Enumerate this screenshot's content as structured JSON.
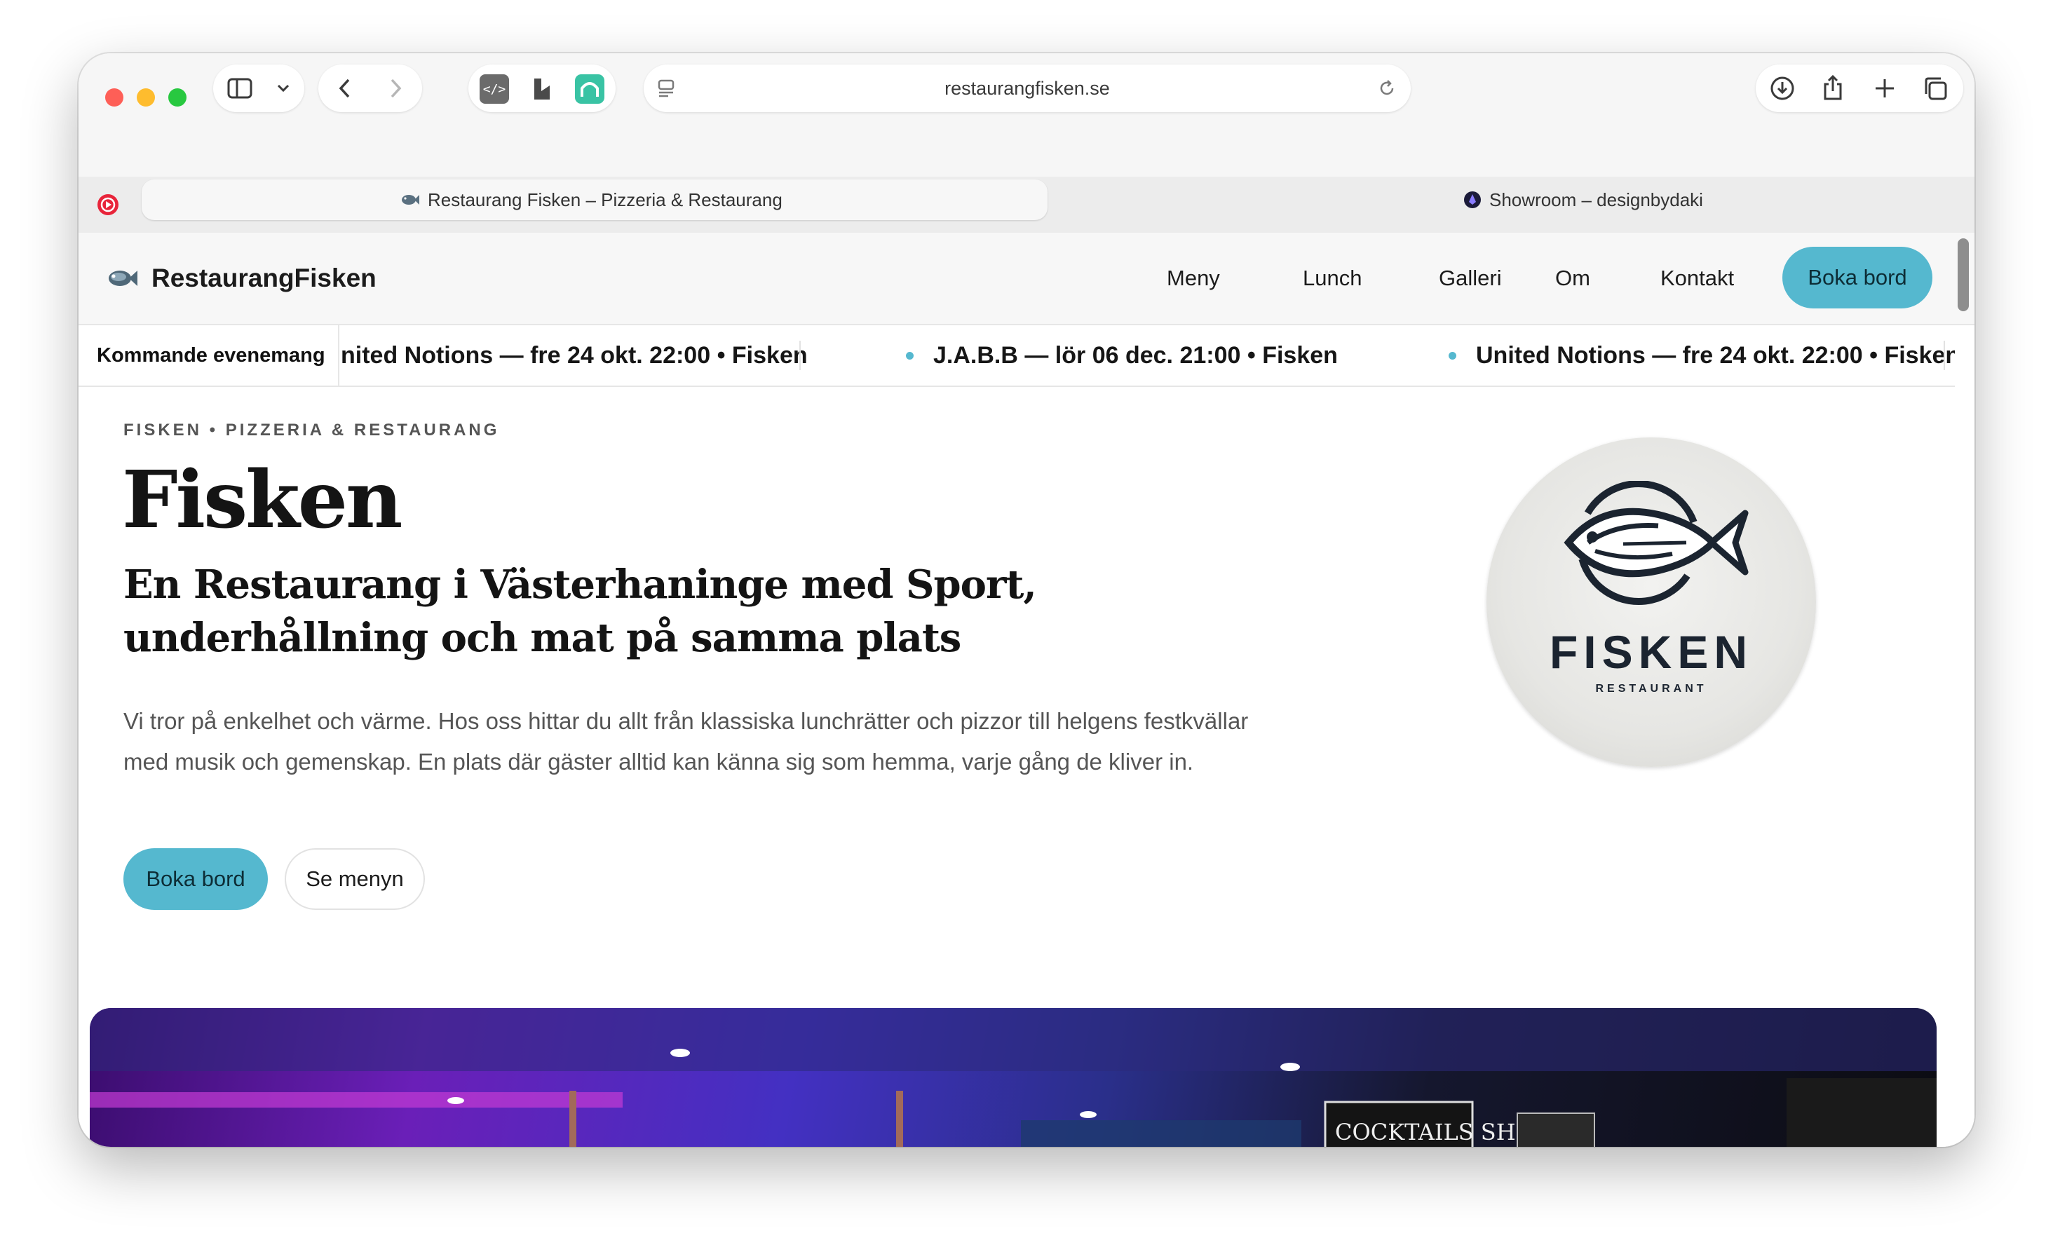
{
  "browser": {
    "url": "restaurangfisken.se",
    "tabs": [
      {
        "label": "Restaurang Fisken – Pizzeria & Restaurang",
        "active": true
      },
      {
        "label": "Showroom – designbydaki",
        "active": false
      }
    ]
  },
  "site": {
    "brand": "RestaurangFisken",
    "nav": [
      "Meny",
      "Lunch",
      "Galleri",
      "Om",
      "Kontakt"
    ],
    "cta": "Boka bord"
  },
  "ticker": {
    "label": "Kommande evenemang",
    "items": [
      "nited Notions — fre 24 okt. 22:00 • Fisken",
      "J.A.B.B — lör 06 dec. 21:00 • Fisken",
      "United Notions — fre 24 okt. 22:00 • Fisken"
    ]
  },
  "hero": {
    "eyebrow": "FISKEN • PIZZERIA & RESTAURANG",
    "title": "Fisken",
    "subtitle": "En Restaurang i Västerhaninge med Sport, underhållning och mat på samma plats",
    "body": "Vi tror på enkelhet och värme. Hos oss hittar du allt från klassiska lunchrätter och pizzor till helgens festkvällar med musik och gemenskap. En plats där gäster alltid kan känna sig som hemma, varje gång de kliver in.",
    "primary_button": "Boka bord",
    "secondary_button": "Se menyn"
  },
  "logo": {
    "word": "FISKEN",
    "small": "RESTAURANT"
  },
  "colors": {
    "accent": "#55b8cf",
    "text": "#141414"
  }
}
